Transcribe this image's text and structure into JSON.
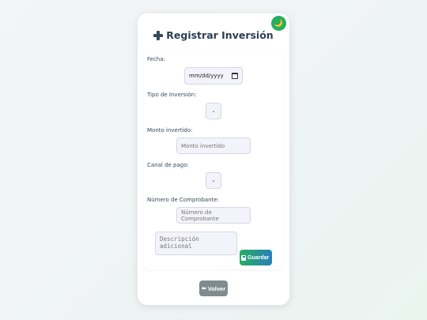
{
  "header": {
    "title": "Registrar Inversión",
    "title_icon": "plus-icon",
    "theme_toggle_icon": "moon-icon",
    "theme_toggle_glyph": "🌙"
  },
  "form": {
    "fecha_label": "Fecha:",
    "fecha_value": "mm/dd/yyyy",
    "tipo_label": "Tipo de Inversión:",
    "tipo_selected": "",
    "monto_label": "Monto invertido:",
    "monto_placeholder": "Monto invertido",
    "canal_label": "Canal de pago:",
    "canal_selected": "",
    "comprobante_label": "Número de Comprobante:",
    "comprobante_placeholder": "Número de Comprobante",
    "descripcion_placeholder": "Descripción adicional",
    "save_label": "Guardar"
  },
  "footer": {
    "back_label": "Volver"
  },
  "colors": {
    "accent_green": "#27ae60",
    "accent_blue": "#2980b9",
    "back_gray": "#7f8c8d",
    "title": "#2c3e50"
  }
}
